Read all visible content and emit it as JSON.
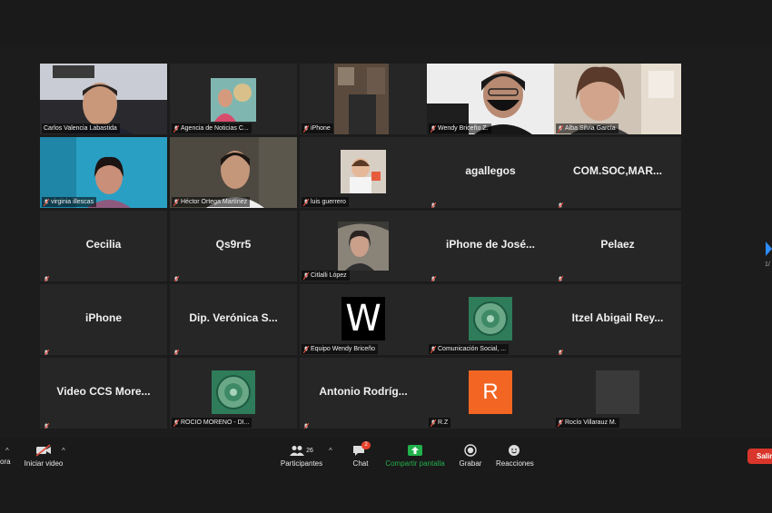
{
  "tiles": [
    {
      "name": "Carlos Valencia Labastida",
      "display": ""
    },
    {
      "name": "Agencia de Noticias C...",
      "display": ""
    },
    {
      "name": "iPhone",
      "display": ""
    },
    {
      "name": "Wendy Briceño Z.",
      "display": ""
    },
    {
      "name": "Alba Silvia García",
      "display": ""
    },
    {
      "name": "virginia illescas",
      "display": ""
    },
    {
      "name": "Héctor Ortega Martínez",
      "display": ""
    },
    {
      "name": "luis guerrero",
      "display": ""
    },
    {
      "name": "",
      "display": "agallegos"
    },
    {
      "name": "",
      "display": "COM.SOC,MAR..."
    },
    {
      "name": "",
      "display": "Cecilia"
    },
    {
      "name": "",
      "display": "Qs9rr5"
    },
    {
      "name": "Citlalli López",
      "display": ""
    },
    {
      "name": "",
      "display": "iPhone de José..."
    },
    {
      "name": "",
      "display": "Pelaez"
    },
    {
      "name": "",
      "display": "iPhone"
    },
    {
      "name": "",
      "display": "Dip. Verónica S..."
    },
    {
      "name": "Equipo Wendy Briceño",
      "display": ""
    },
    {
      "name": "Comunicación Social, ...",
      "display": ""
    },
    {
      "name": "",
      "display": "Itzel Abigail Rey..."
    },
    {
      "name": "",
      "display": "Video CCS More..."
    },
    {
      "name": "ROCIO MORENO - DI...",
      "display": ""
    },
    {
      "name": "",
      "display": "Antonio Rodríg..."
    },
    {
      "name": "R.Z",
      "display": ""
    },
    {
      "name": "Rocío Villarauz M.",
      "display": ""
    }
  ],
  "avatars": {
    "w_letter": "W",
    "r_letter": "R"
  },
  "side_page": "1/",
  "toolbar": {
    "mute_label": "ora",
    "video_label": "Iniciar video",
    "participants_label": "Participantes",
    "participants_count": "26",
    "chat_label": "Chat",
    "chat_badge": "2",
    "share_label": "Compartir pantalla",
    "record_label": "Grabar",
    "reactions_label": "Reacciones",
    "leave_label": "Salir"
  },
  "colors": {
    "speaker_outline": "#d4d23a",
    "share_green": "#22b14c",
    "leave_red": "#d9362b",
    "chat_badge": "#e8412c",
    "r_avatar": "#f26522"
  }
}
